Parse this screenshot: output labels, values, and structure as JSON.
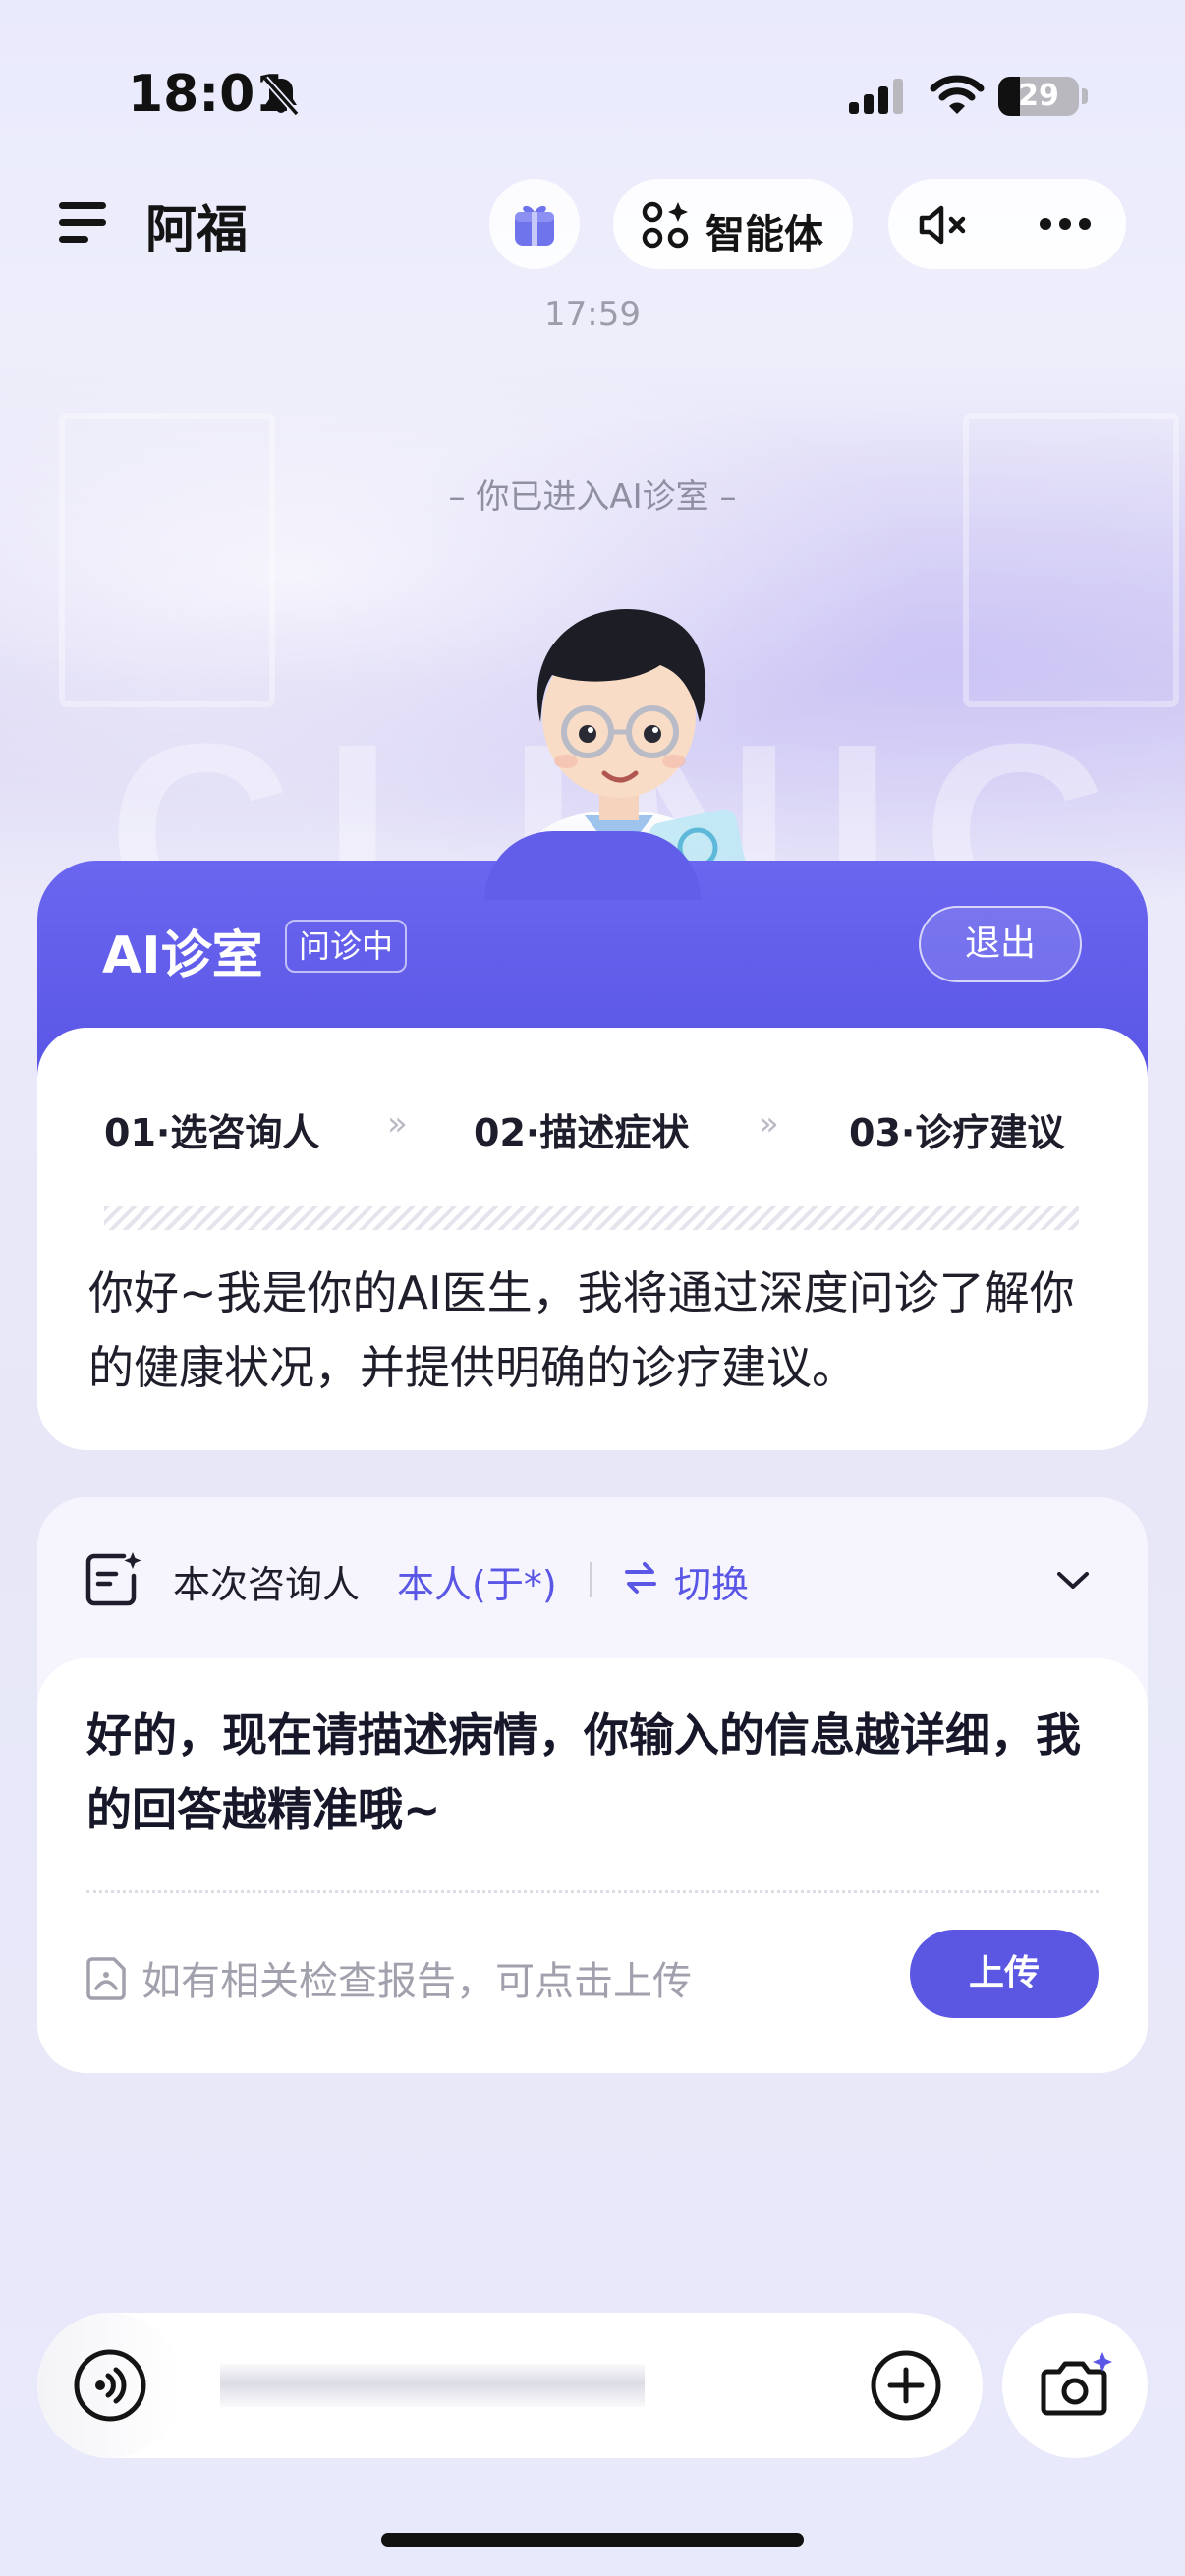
{
  "status_bar": {
    "time": "18:01",
    "battery": "29",
    "icons": [
      "bell-slash-icon",
      "signal-icon",
      "wifi-icon",
      "battery-icon"
    ]
  },
  "header": {
    "title": "阿福",
    "agent_label": "智能体",
    "icons": [
      "menu-icon",
      "gift-icon",
      "agent-grid-icon",
      "speaker-mute-icon",
      "more-icon"
    ]
  },
  "chat": {
    "timestamp": "17:59",
    "enter_note": "–   你已进入AI诊室   –"
  },
  "background": {
    "decor_word": "CLINIC"
  },
  "clinic_card": {
    "title": "AI诊室",
    "status": "问诊中",
    "exit_label": "退出",
    "steps": [
      "01·选咨询人",
      "02·描述症状",
      "03·诊疗建议"
    ],
    "step_separator": "»",
    "intro": "你好~我是你的AI医生，我将通过深度问诊了解你的健康状况，并提供明确的诊疗建议。"
  },
  "consult_card": {
    "label": "本次咨询人",
    "person": "本人(于*)",
    "switch_label": "切换",
    "reply": "好的，现在请描述病情，你输入的信息越详细，我的回答越精准哦~",
    "report_hint": "如有相关检查报告，可点击上传",
    "upload_label": "上传"
  },
  "input_bar": {
    "placeholder": "",
    "icons": [
      "voice-icon",
      "plus-icon",
      "camera-sparkle-icon"
    ]
  },
  "colors": {
    "accent": "#5a56e6",
    "card_header": "#635ee9",
    "text_dark": "#1d1d2b",
    "text_muted": "#a0a1ad"
  }
}
